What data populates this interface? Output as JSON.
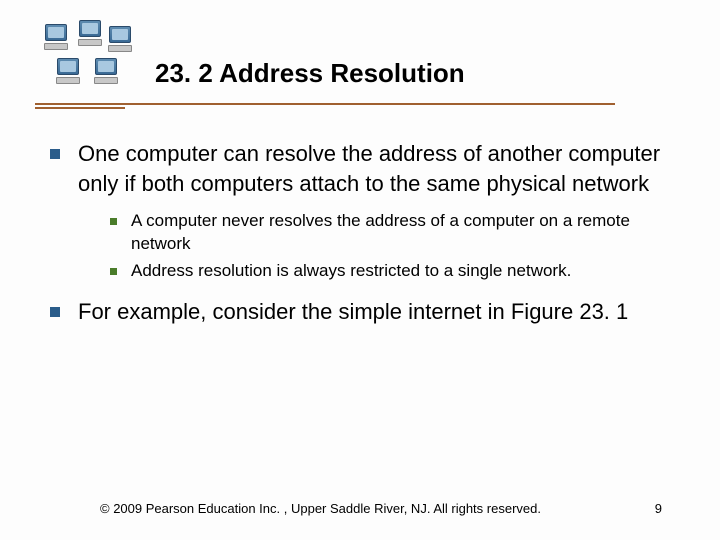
{
  "title": "23. 2  Address Resolution",
  "bullets": [
    {
      "text": "One computer can resolve the address of another computer only if both computers attach to the same physical network",
      "sub": [
        "A computer never resolves the address of a computer on a remote network",
        "Address resolution is always restricted to a single network."
      ]
    },
    {
      "text": "For example, consider the simple internet in Figure 23. 1",
      "sub": []
    }
  ],
  "footer": {
    "copyright": "© 2009 Pearson Education Inc. , Upper Saddle River, NJ. All rights reserved.",
    "page": "9"
  }
}
